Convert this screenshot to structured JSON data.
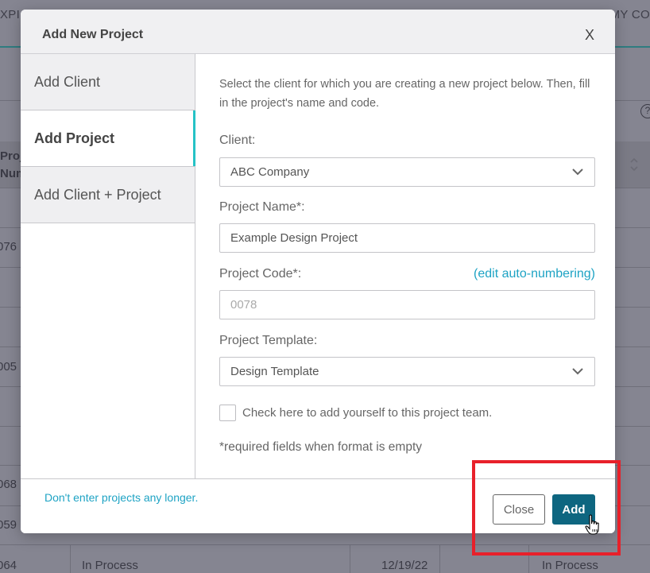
{
  "background": {
    "nav_left_text": "XPI",
    "nav_right_text": "MY CO",
    "header_col_text": [
      "Proj",
      "Num"
    ],
    "rows": [
      {
        "num": "076"
      },
      {
        "num": "005"
      },
      {
        "num": "068"
      },
      {
        "num": "059"
      },
      {
        "num": "064",
        "status": "In Process",
        "date": "12/19/22",
        "status2": "In Process"
      }
    ],
    "help_icon_glyph": "?"
  },
  "modal": {
    "title": "Add New Project",
    "close_glyph": "X",
    "tabs": [
      {
        "label": "Add Client",
        "active": false
      },
      {
        "label": "Add Project",
        "active": true
      },
      {
        "label": "Add Client + Project",
        "active": false
      }
    ],
    "intro_text": "Select the client for which you are creating a new project below. Then, fill in the project's name and code.",
    "client": {
      "label": "Client:",
      "value": "ABC Company"
    },
    "project_name": {
      "label": "Project Name*:",
      "value": "Example Design Project"
    },
    "project_code": {
      "label": "Project Code*:",
      "placeholder": "0078",
      "edit_link": "(edit auto-numbering)"
    },
    "project_template": {
      "label": "Project Template:",
      "value": "Design Template"
    },
    "checkbox": {
      "label": "Check here to add yourself to this project team.",
      "checked": false
    },
    "required_note": "*required fields when format is empty",
    "footer": {
      "link": "Don't enter projects any longer.",
      "close_label": "Close",
      "add_label": "Add"
    }
  },
  "colors": {
    "accent_teal": "#25c2c6",
    "link_blue": "#1ea3c4",
    "primary_button": "#0e6680",
    "highlight_red": "#e8202a"
  }
}
